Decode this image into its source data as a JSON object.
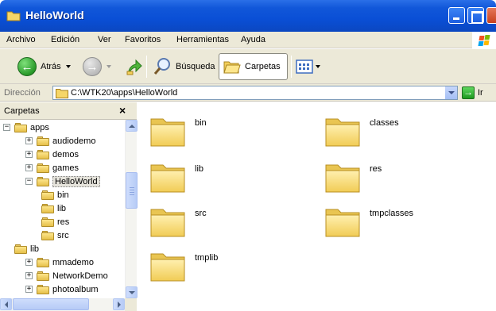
{
  "window": {
    "title": "HelloWorld",
    "colors": {
      "titlebar": "#0a4fd6",
      "chrome": "#ece9d8",
      "folder": "#f5d36a"
    }
  },
  "menu": [
    "Archivo",
    "Edición",
    "Ver",
    "Favoritos",
    "Herramientas",
    "Ayuda"
  ],
  "toolbar": {
    "back_label": "Atrás",
    "search_label": "Búsqueda",
    "folders_label": "Carpetas"
  },
  "address": {
    "label": "Dirección",
    "path": "C:\\WTK20\\apps\\HelloWorld",
    "go_label": "Ir"
  },
  "folders_pane": {
    "title": "Carpetas",
    "close_glyph": "×",
    "tree": [
      {
        "label": "apps",
        "expander": "−"
      },
      {
        "label": "audiodemo",
        "expander": "+"
      },
      {
        "label": "demos",
        "expander": "+"
      },
      {
        "label": "games",
        "expander": "+"
      },
      {
        "label": "HelloWorld",
        "expander": "−"
      },
      {
        "label": "bin",
        "expander": ""
      },
      {
        "label": "lib",
        "expander": ""
      },
      {
        "label": "res",
        "expander": ""
      },
      {
        "label": "src",
        "expander": ""
      },
      {
        "label": "lib",
        "expander": ""
      },
      {
        "label": "mmademo",
        "expander": "+"
      },
      {
        "label": "NetworkDemo",
        "expander": "+"
      },
      {
        "label": "photoalbum",
        "expander": "+"
      }
    ]
  },
  "content": {
    "items": [
      "bin",
      "classes",
      "lib",
      "res",
      "src",
      "tmpclasses",
      "tmplib"
    ]
  }
}
